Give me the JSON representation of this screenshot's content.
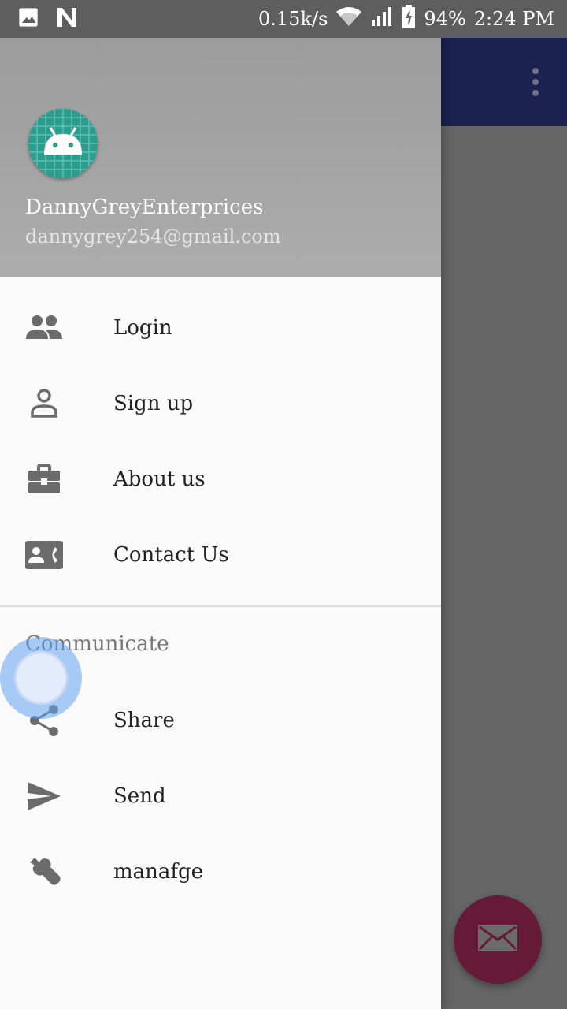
{
  "status_bar": {
    "speed": "0.15k/s",
    "battery": "94%",
    "time": "2:24 PM",
    "icons": [
      "image-icon",
      "n-notification-icon",
      "wifi-icon",
      "signal-icon",
      "battery-charging-icon"
    ]
  },
  "app_bar": {
    "menu_icon": "more-vert-icon"
  },
  "drawer": {
    "header": {
      "name": "DannyGreyEnterprices",
      "email": "dannygrey254@gmail.com",
      "avatar_icon": "android-icon"
    },
    "items": [
      {
        "label": "Login",
        "icon": "people-icon"
      },
      {
        "label": "Sign up",
        "icon": "person-outline-icon"
      },
      {
        "label": "About us",
        "icon": "briefcase-icon"
      },
      {
        "label": "Contact Us",
        "icon": "contact-phone-icon"
      }
    ],
    "section": {
      "title": "Communicate",
      "items": [
        {
          "label": "Share",
          "icon": "share-icon"
        },
        {
          "label": "Send",
          "icon": "send-icon"
        },
        {
          "label": "manafge",
          "icon": "wrench-icon"
        }
      ]
    }
  },
  "fab": {
    "icon": "email-icon"
  },
  "colors": {
    "app_bar": "#1b2150",
    "drawer_header": "#a4a4a4",
    "avatar": "#2a9d8f",
    "fab": "#651a35",
    "icon": "#6b6b6b"
  }
}
